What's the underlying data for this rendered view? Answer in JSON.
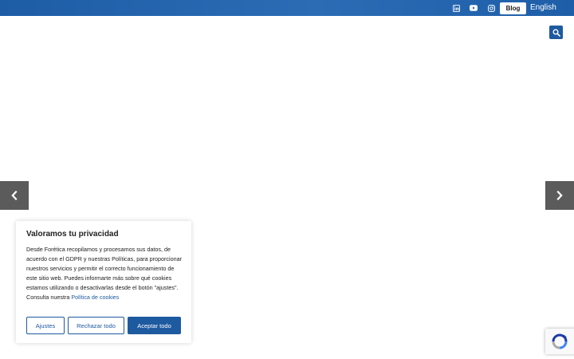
{
  "header": {
    "social": [
      {
        "name": "linkedin-icon"
      },
      {
        "name": "youtube-icon"
      },
      {
        "name": "instagram-icon"
      }
    ],
    "blog_label": "Blog",
    "language_label": "English"
  },
  "search": {
    "icon": "search-icon"
  },
  "slider": {
    "prev_icon": "chevron-left-icon",
    "next_icon": "chevron-right-icon"
  },
  "cookie_banner": {
    "title": "Valoramos tu privacidad",
    "body": "Desde Forética recopilamos y procesamos sus datos, de acuerdo con el GDPR y nuestras Políticas, para proporcionar nuestros servicios y permitir el correcto funcionamiento de este sitio web. Puedes informarte más sobre qué cookies estamos utilizando o desactivarlas desde el botón \"ajustes\". Consulta nuestra",
    "link_label": "Política de cookies",
    "settings_label": "Ajustes",
    "reject_label": "Rechazar todo",
    "accept_label": "Aceptar todo"
  },
  "colors": {
    "brand_blue": "#1e5aa0",
    "topbar_blue": "#2b6cb5",
    "arrow_gray": "#5b5b5b"
  }
}
